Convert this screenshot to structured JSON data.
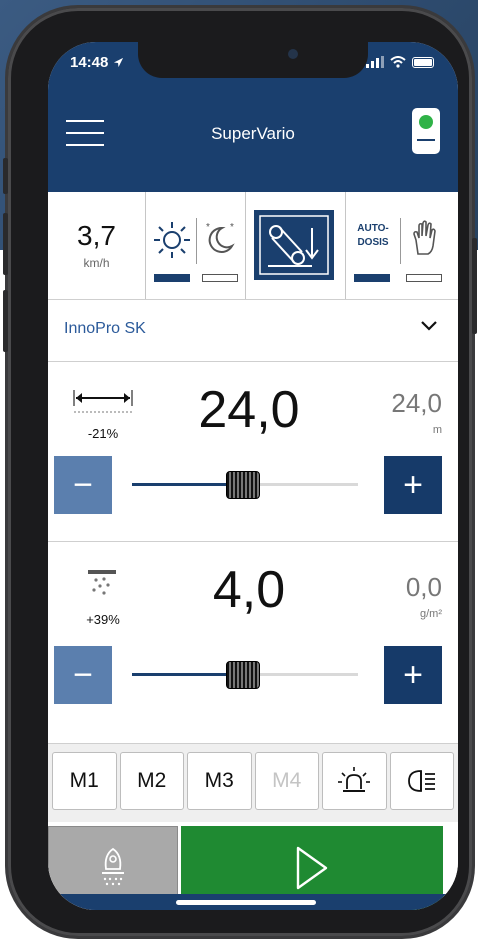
{
  "status": {
    "time": "14:48"
  },
  "header": {
    "title": "SuperVario"
  },
  "mode": {
    "speed_value": "3,7",
    "speed_unit": "km/h",
    "auto_label_1": "AUTO-",
    "auto_label_2": "DOSIS"
  },
  "product": {
    "name": "InnoPro SK"
  },
  "width_panel": {
    "value": "24,0",
    "percent": "-21%",
    "actual_value": "24,0",
    "actual_unit": "m",
    "minus_label": "−",
    "plus_label": "+",
    "slider_level": 0.49
  },
  "rate_panel": {
    "value": "4,0",
    "percent": "+39%",
    "actual_value": "0,0",
    "actual_unit": "g/m²",
    "minus_label": "−",
    "plus_label": "+",
    "slider_level": 0.49
  },
  "memory": {
    "m1": "M1",
    "m2": "M2",
    "m3": "M3",
    "m4": "M4"
  },
  "colors": {
    "primary": "#1a3f6e",
    "minus_button": "#5b7fae",
    "play_green": "#1f8a32",
    "status_led": "#2fb247"
  },
  "icons": [
    "menu-icon",
    "device-status-icon",
    "sun-icon",
    "moon-icon",
    "lever-icon",
    "hand-icon",
    "chevron-down-icon",
    "width-icon",
    "spread-rate-icon",
    "beacon-icon",
    "headlight-icon",
    "spreader-icon",
    "play-icon"
  ]
}
